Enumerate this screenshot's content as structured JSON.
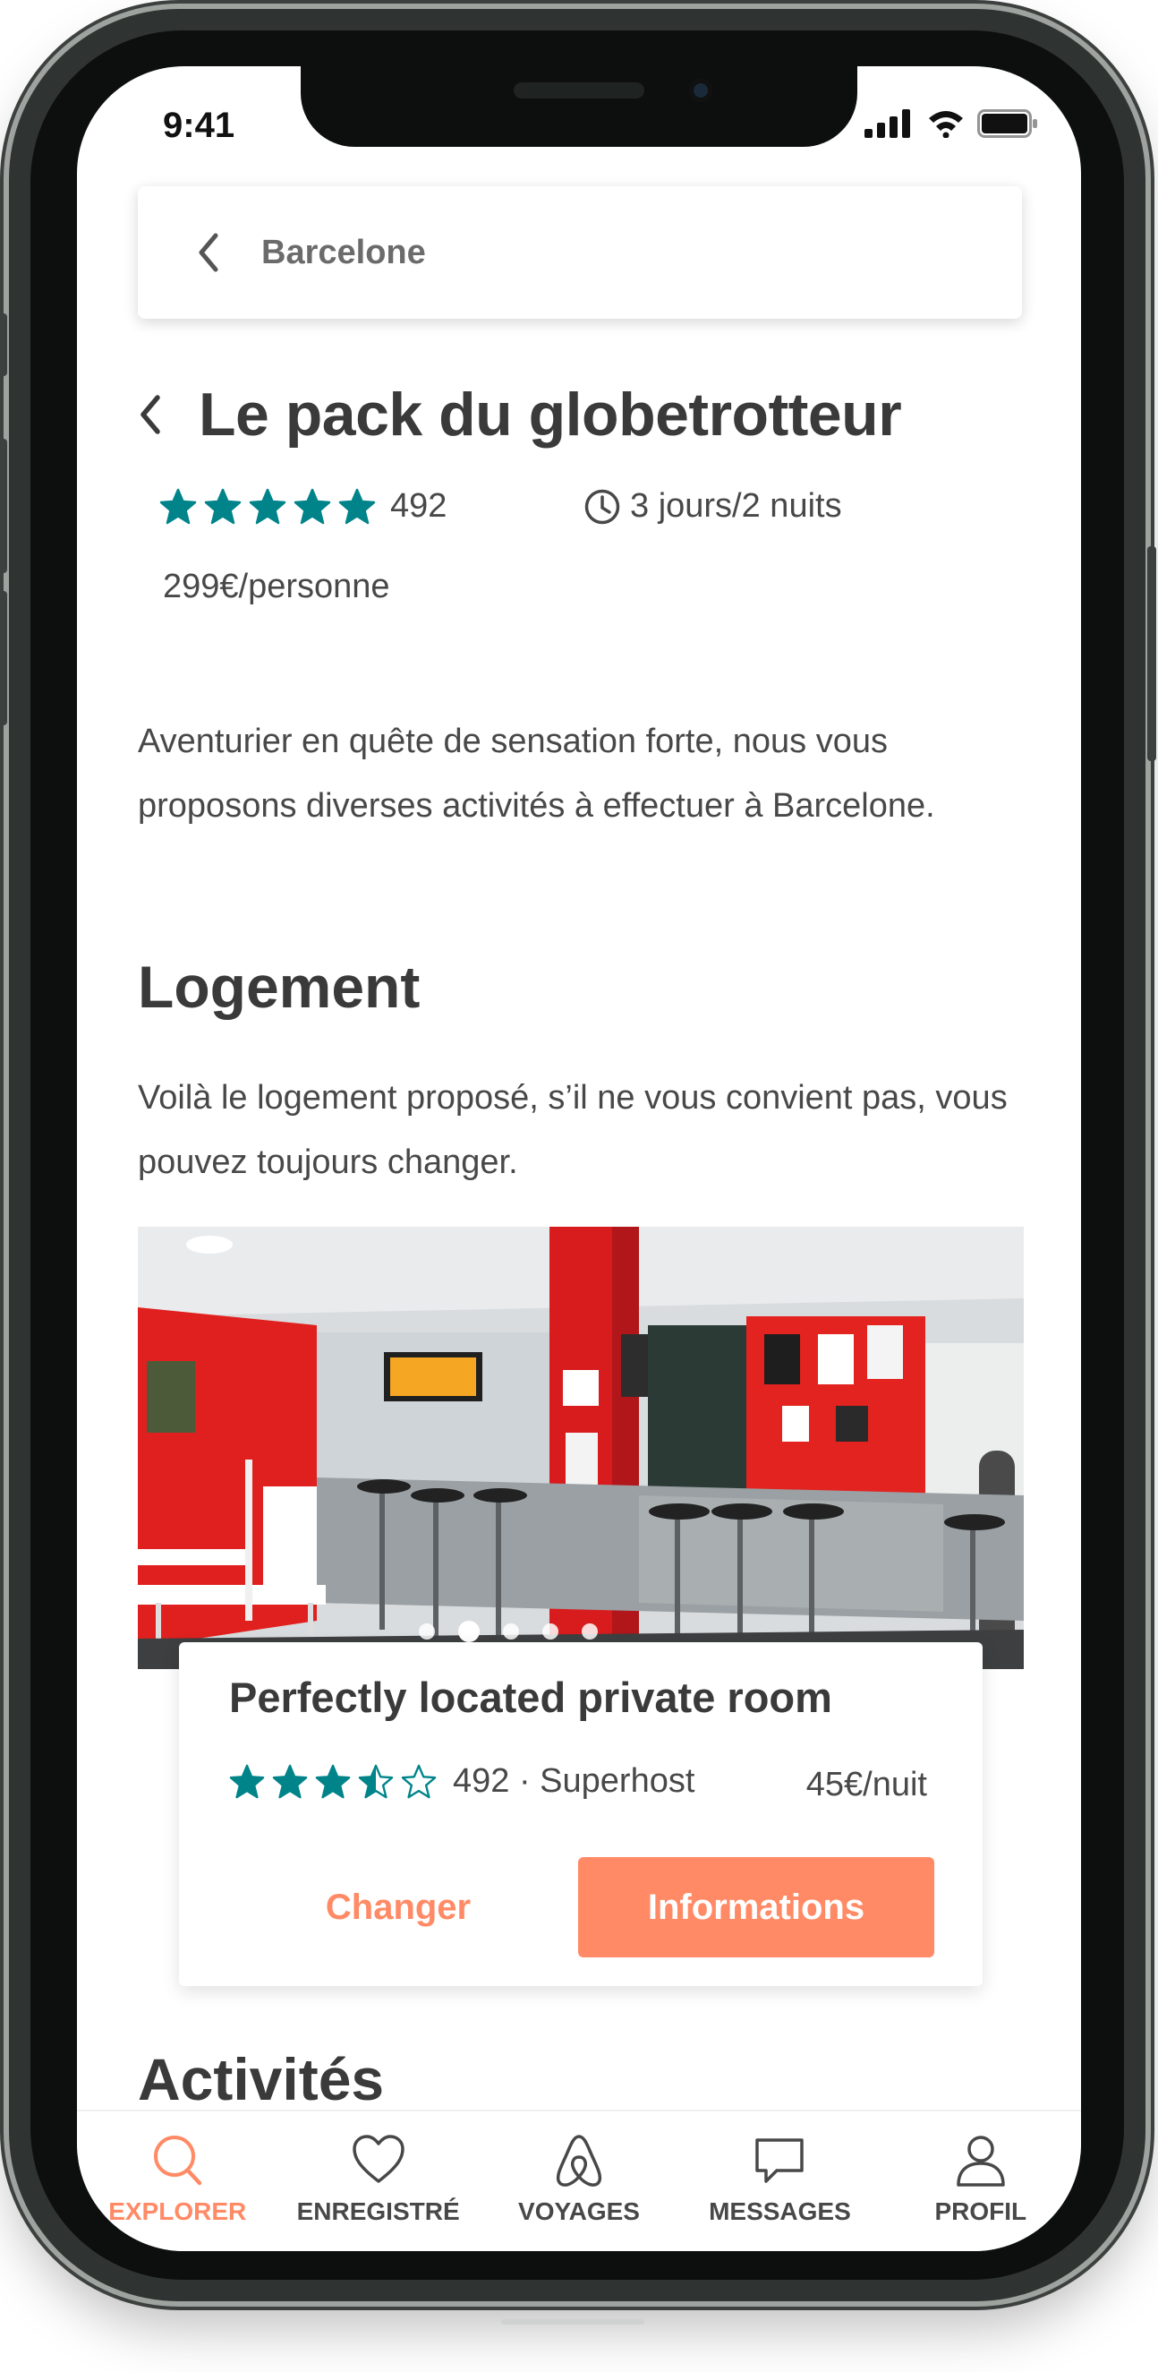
{
  "status": {
    "time": "9:41"
  },
  "search": {
    "back_icon": "chevron-left-icon",
    "text": "Barcelone"
  },
  "title": {
    "back_icon": "chevron-left-icon",
    "text": "Le pack du globetrotteur"
  },
  "meta": {
    "rating_stars": 5,
    "rating_count": "492",
    "duration_icon": "clock-icon",
    "duration": "3 jours/2 nuits"
  },
  "price": "299€/personne",
  "description": "Aventurier en quête de sensation forte, nous vous proposons diverses activités à effectuer à Barcelone.",
  "section_logement": {
    "heading": "Logement",
    "text": "Voilà le logement proposé, s’il ne vous convient pas, vous pouvez toujours changer."
  },
  "carousel": {
    "image": "hostel-bar-room-photo",
    "dot_count": 5,
    "active_dot": 2
  },
  "listing": {
    "title": "Perfectly located private room",
    "rating_stars": 3.5,
    "rating_text": "492 · Superhost",
    "price": "45€/nuit",
    "changer_label": "Changer",
    "info_label": "Informations"
  },
  "section_activites": {
    "heading": "Activités"
  },
  "tabbar": {
    "active": "explorer",
    "items": [
      {
        "id": "explorer",
        "label": "EXPLORER",
        "icon": "search-icon"
      },
      {
        "id": "enregistre",
        "label": "ENREGISTRÉ",
        "icon": "heart-icon"
      },
      {
        "id": "voyages",
        "label": "VOYAGES",
        "icon": "airbnb-logo-icon"
      },
      {
        "id": "messages",
        "label": "MESSAGES",
        "icon": "message-icon"
      },
      {
        "id": "profil",
        "label": "PROFIL",
        "icon": "user-icon"
      }
    ]
  },
  "colors": {
    "accent": "#ff8a65",
    "star": "#00848a",
    "text": "#484848",
    "heading": "#3a3a3a"
  }
}
